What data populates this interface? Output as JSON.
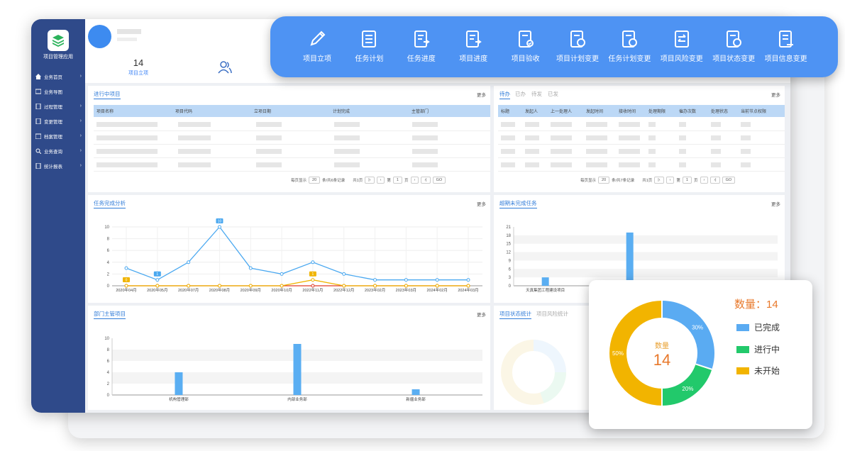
{
  "app": {
    "name": "项目管理应用"
  },
  "sidebar": {
    "items": [
      {
        "label": "业务首页"
      },
      {
        "label": "业务导图"
      },
      {
        "label": "过程管理"
      },
      {
        "label": "变更管理"
      },
      {
        "label": "档案管理"
      },
      {
        "label": "业务查询"
      },
      {
        "label": "统计报表"
      }
    ]
  },
  "topbar": {
    "stat_value": "14",
    "stat_label": "项目立项"
  },
  "quick_actions": [
    {
      "label": "项目立项",
      "icon": "pencil-icon"
    },
    {
      "label": "任务计划",
      "icon": "list-doc-icon"
    },
    {
      "label": "任务进度",
      "icon": "progress-doc-icon"
    },
    {
      "label": "项目进度",
      "icon": "progress-doc-icon"
    },
    {
      "label": "项目验收",
      "icon": "check-doc-icon"
    },
    {
      "label": "项目计划变更",
      "icon": "refresh-doc-icon"
    },
    {
      "label": "任务计划变更",
      "icon": "refresh-doc-icon"
    },
    {
      "label": "项目风险变更",
      "icon": "swap-icon"
    },
    {
      "label": "项目状态变更",
      "icon": "refresh-doc-icon"
    },
    {
      "label": "项目信息变更",
      "icon": "edit-doc-icon"
    }
  ],
  "ongoing": {
    "title": "进行中项目",
    "more": "更多",
    "columns": [
      "项目名称",
      "立项日期",
      "计划完成",
      "主管部门"
    ],
    "col_code": "项目代码",
    "pager": {
      "per_page_label": "每页显示",
      "per_page": "20",
      "records": "条/共6条记录",
      "total_pages": "共1页",
      "page_prefix": "第",
      "page": "1",
      "page_suffix": "页",
      "go": "GO"
    }
  },
  "todo": {
    "tabs": [
      "待办",
      "已办",
      "待发",
      "已发"
    ],
    "more": "更多",
    "columns": [
      "标题",
      "发起人",
      "上一处理人",
      "发起时间",
      "接收时间",
      "处理期限",
      "催办次数",
      "处理状态",
      "当前节点权限"
    ],
    "pager": {
      "per_page_label": "每页显示",
      "per_page": "20",
      "records": "条/共7条记录",
      "total_pages": "共1页",
      "page_prefix": "第",
      "page": "1",
      "page_suffix": "页",
      "go": "GO"
    }
  },
  "task_analysis": {
    "title": "任务完成分析",
    "more": "更多"
  },
  "overdue": {
    "title": "超期未完成任务",
    "more": "更多"
  },
  "dept": {
    "title": "部门主管项目",
    "more": "更多"
  },
  "status_stats": {
    "tabs": [
      "项目状态统计",
      "项目风险统计"
    ],
    "more": "更多"
  },
  "donut": {
    "center_label": "数量",
    "center_value": "14",
    "count_label": "数量：14"
  },
  "chart_data": [
    {
      "type": "line",
      "x": [
        "2020年04月",
        "2020年05月",
        "2020年07月",
        "2020年08月",
        "2020年09月",
        "2020年10月",
        "2022年11月",
        "2022年12月",
        "2023年02月",
        "2023年03月",
        "2024年02月",
        "2024年03月"
      ],
      "series": [
        {
          "values": [
            3,
            1,
            4,
            10,
            3,
            2,
            4,
            2,
            1,
            1,
            1,
            1
          ],
          "color": "#4aa8f0"
        },
        {
          "values": [
            0,
            0,
            0,
            0,
            0,
            0,
            1,
            0,
            0,
            0,
            0,
            0
          ],
          "color": "#f0b400"
        },
        {
          "values": [
            0,
            0,
            0,
            0,
            0,
            0,
            0,
            0,
            0,
            0,
            0,
            0
          ],
          "color": "#e03c28"
        }
      ],
      "point_labels": [
        {
          "index": 1,
          "text": "1"
        },
        {
          "index": 3,
          "text": "10"
        }
      ],
      "point_labels_2": [
        {
          "index": 0,
          "text": "0"
        },
        {
          "index": 6,
          "text": "1"
        }
      ],
      "ylim": [
        0,
        10
      ],
      "yticks": [
        0,
        2,
        4,
        6,
        8,
        10
      ]
    },
    {
      "type": "bar",
      "categories": [
        "天真集团工程建设项目",
        ""
      ],
      "values": [
        3,
        19
      ],
      "ylim": [
        0,
        21
      ],
      "yticks": [
        0,
        3,
        6,
        9,
        12,
        15,
        18,
        21
      ]
    },
    {
      "type": "bar",
      "categories": [
        "机构管理部",
        "内部业务部",
        "新疆业务部"
      ],
      "values": [
        4,
        9,
        1
      ],
      "ylim": [
        0,
        10
      ],
      "yticks": [
        0,
        2,
        4,
        6,
        8,
        10
      ]
    },
    {
      "type": "pie",
      "series": [
        {
          "name": "已完成",
          "value": 30,
          "color": "#5aabf2"
        },
        {
          "name": "进行中",
          "value": 20,
          "color": "#22c96b"
        },
        {
          "name": "未开始",
          "value": 50,
          "color": "#f2b400"
        }
      ]
    }
  ]
}
